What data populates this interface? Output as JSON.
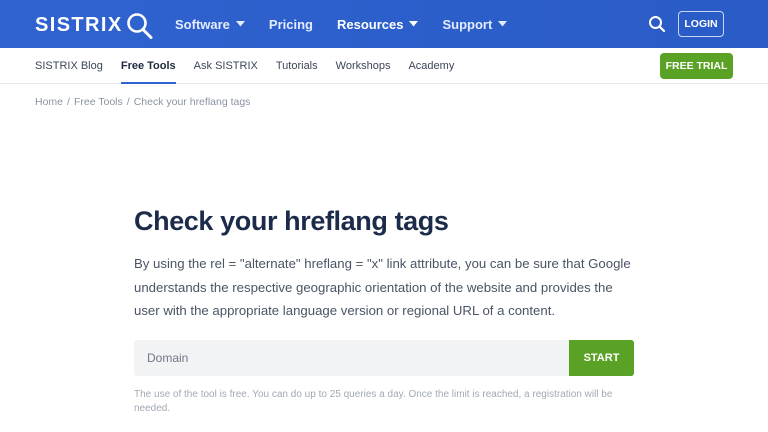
{
  "brand": {
    "name": "SISTRIX"
  },
  "main_nav": {
    "items": [
      {
        "label": "Software",
        "has_dropdown": true
      },
      {
        "label": "Pricing",
        "has_dropdown": false
      },
      {
        "label": "Resources",
        "has_dropdown": true
      },
      {
        "label": "Support",
        "has_dropdown": true
      }
    ],
    "search_icon": "search-icon",
    "login_label": "LOGIN"
  },
  "sub_nav": {
    "items": [
      {
        "label": "SISTRIX Blog",
        "active": false
      },
      {
        "label": "Free Tools",
        "active": true
      },
      {
        "label": "Ask SISTRIX",
        "active": false
      },
      {
        "label": "Tutorials",
        "active": false
      },
      {
        "label": "Workshops",
        "active": false
      },
      {
        "label": "Academy",
        "active": false
      }
    ],
    "trial_label": "FREE TRIAL"
  },
  "breadcrumb": {
    "items": [
      "Home",
      "Free Tools",
      "Check your hreflang tags"
    ],
    "separator": "/"
  },
  "main": {
    "title": "Check your hreflang tags",
    "intro": "By using the rel = \"alternate\" hreflang = \"x\" link attribute, you can be sure that Google understands the respective geographic orientation of the website and provides the user with the appropriate language version or regional URL of a content.",
    "input_placeholder": "Domain",
    "input_value": "",
    "start_label": "START",
    "note": "The use of the tool is free. You can do up to 25 queries a day. Once the limit is reached, a registration will be needed."
  },
  "colors": {
    "header_blue": "#2f63cf",
    "cta_green": "#5aa226",
    "title_navy": "#1c2b4a"
  }
}
